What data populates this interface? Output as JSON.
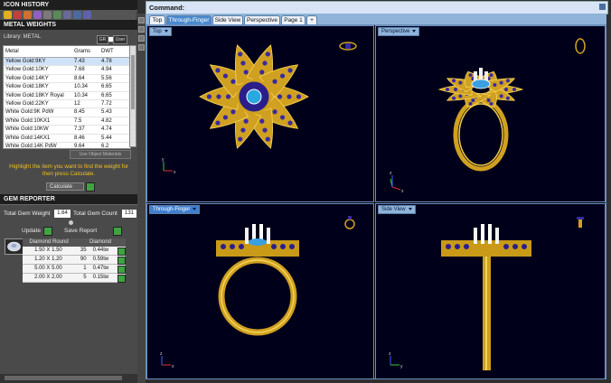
{
  "left_panel": {
    "icon_history_title": "ICON HISTORY",
    "metal_weights": {
      "title": "METAL WEIGHTS",
      "library_label": "Library: METAL",
      "unit_gr": "GR",
      "unit_user": "User",
      "columns": [
        "Metal",
        "Grams",
        "DWT"
      ],
      "rows": [
        {
          "metal": "Yellow Gold:9KY",
          "grams": "7.43",
          "dwt": "4.78"
        },
        {
          "metal": "Yellow Gold:10KY",
          "grams": "7.68",
          "dwt": "4.94"
        },
        {
          "metal": "Yellow Gold:14KY",
          "grams": "8.64",
          "dwt": "5.56"
        },
        {
          "metal": "Yellow Gold:18KY",
          "grams": "10.34",
          "dwt": "6.65"
        },
        {
          "metal": "Yellow Gold:18KY Royal",
          "grams": "10.34",
          "dwt": "6.65"
        },
        {
          "metal": "Yellow Gold:22KY",
          "grams": "12",
          "dwt": "7.72"
        },
        {
          "metal": "White Gold:9K PdW",
          "grams": "8.45",
          "dwt": "5.43"
        },
        {
          "metal": "White Gold:10KX1",
          "grams": "7.5",
          "dwt": "4.82"
        },
        {
          "metal": "White Gold:10KW",
          "grams": "7.37",
          "dwt": "4.74"
        },
        {
          "metal": "White Gold:14KX1",
          "grams": "8.46",
          "dwt": "5.44"
        },
        {
          "metal": "White Gold:14K PdW",
          "grams": "9.64",
          "dwt": "6.2"
        }
      ],
      "use_object_materials": "Use Object Materials",
      "hint": "Highlight the item you want to find the weight for then press Calculate.",
      "calculate_label": "Calculate"
    },
    "gem_reporter": {
      "title": "GEM REPORTER",
      "total_gem_weight_label": "Total Gem Weight",
      "total_gem_weight": "1.64",
      "total_gem_count_label": "Total Gem Count",
      "total_gem_count": "131",
      "update_label": "Update",
      "save_report_label": "Save Report",
      "gem_shape": "Diamond Round",
      "gem_material": "Diamond",
      "rows": [
        {
          "size": "1.50 X 1.50",
          "count": "35",
          "weight": "0.44tw"
        },
        {
          "size": "1.20 X 1.20",
          "count": "90",
          "weight": "0.59tw"
        },
        {
          "size": "5.00 X 5.00",
          "count": "1",
          "weight": "0.47tw"
        },
        {
          "size": "2.00 X 2.00",
          "count": "5",
          "weight": "0.15tw"
        }
      ]
    }
  },
  "command_bar": {
    "label": "Command:"
  },
  "tabs": [
    {
      "label": "Top",
      "active": false
    },
    {
      "label": "Through-Finger",
      "active": true
    },
    {
      "label": "Side View",
      "active": false
    },
    {
      "label": "Perspective",
      "active": false
    },
    {
      "label": "Page 1",
      "active": false
    },
    {
      "label": "+",
      "active": false
    }
  ],
  "viewports": [
    {
      "label": "Top",
      "active": false
    },
    {
      "label": "Perspective",
      "active": false
    },
    {
      "label": "Through-Finger",
      "active": true
    },
    {
      "label": "Side View",
      "active": false
    }
  ],
  "axis_labels": {
    "x": "x",
    "y": "y",
    "z": "z"
  },
  "colors": {
    "viewport_bg": "#00001a",
    "gold": "#e0b020",
    "sapphire": "#3a2aa0",
    "metal_header": "#1e1e1e",
    "hint": "#f0c020",
    "go_button": "#3fa33f",
    "tab_active": "#4a8ad0"
  }
}
